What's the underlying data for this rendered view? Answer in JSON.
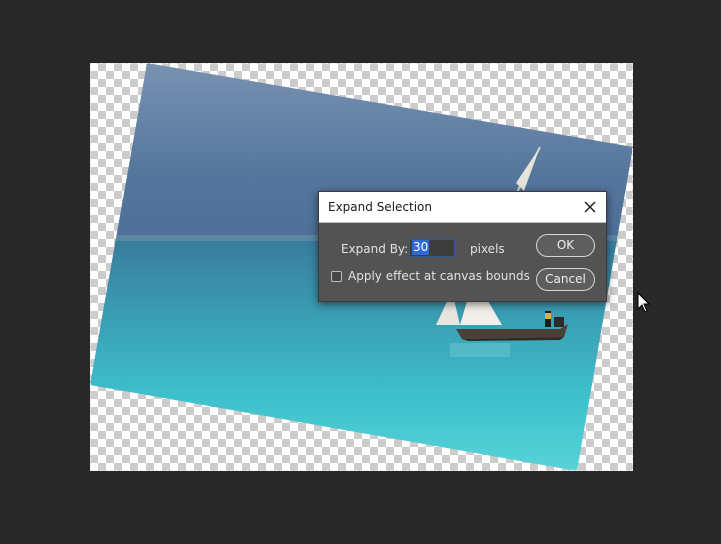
{
  "dialog": {
    "title": "Expand Selection",
    "expand_label": "Expand By:",
    "expand_value": "30",
    "unit": "pixels",
    "canvas_bounds_label": "Apply effect at canvas bounds",
    "canvas_bounds_checked": false,
    "ok_label": "OK",
    "cancel_label": "Cancel"
  },
  "colors": {
    "workspace_bg": "#282828",
    "dialog_bg": "#535353",
    "input_highlight": "#2d6ad6",
    "sky_top": "#6f8fb0",
    "sea": "#3ec4cf"
  },
  "icons": {
    "close": "close-icon",
    "cursor": "mouse-pointer-icon"
  }
}
